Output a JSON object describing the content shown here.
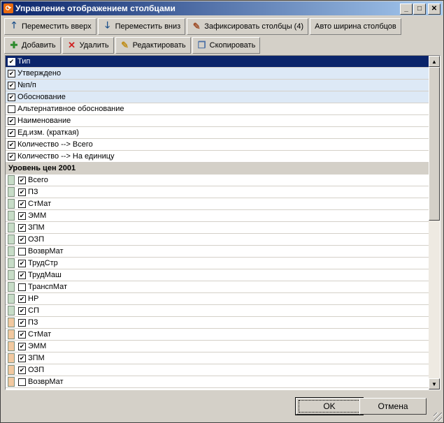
{
  "window": {
    "title": "Управление отображением столбцами"
  },
  "toolbar1": [
    {
      "label": "Переместить вверх",
      "icon": "arrow-up-icon"
    },
    {
      "label": "Переместить вниз",
      "icon": "arrow-down-icon"
    },
    {
      "label": "Зафиксировать столбцы (4)",
      "icon": "pin-icon"
    },
    {
      "label": "Авто ширина столбцов",
      "icon": ""
    }
  ],
  "toolbar2": [
    {
      "label": "Добавить",
      "icon": "plus-icon"
    },
    {
      "label": "Удалить",
      "icon": "delete-x-icon"
    },
    {
      "label": "Редактировать",
      "icon": "edit-icon"
    },
    {
      "label": "Скопировать",
      "icon": "copy-icon"
    }
  ],
  "rows": [
    {
      "label": "Тип",
      "checked": true,
      "style": "selected"
    },
    {
      "label": "Утверждено",
      "checked": true,
      "style": "alt"
    },
    {
      "label": "№п/п",
      "checked": true,
      "style": "alt"
    },
    {
      "label": "Обоснование",
      "checked": true,
      "style": "alt"
    },
    {
      "label": "Альтернативное обоснование",
      "checked": false,
      "style": ""
    },
    {
      "label": "Наименование",
      "checked": true,
      "style": ""
    },
    {
      "label": "Ед.изм. (краткая)",
      "checked": true,
      "style": ""
    },
    {
      "label": "Количество --> Всего",
      "checked": true,
      "style": ""
    },
    {
      "label": "Количество --> На единицу",
      "checked": true,
      "style": ""
    },
    {
      "label": "Уровень цен 2001",
      "group": true
    },
    {
      "label": "Всего",
      "checked": true,
      "swatch": "#c7dcc7"
    },
    {
      "label": "ПЗ",
      "checked": true,
      "swatch": "#c7dcc7"
    },
    {
      "label": "СтМат",
      "checked": true,
      "swatch": "#c7dcc7"
    },
    {
      "label": "ЭММ",
      "checked": true,
      "swatch": "#c7dcc7"
    },
    {
      "label": "ЗПМ",
      "checked": true,
      "swatch": "#c7dcc7"
    },
    {
      "label": "ОЗП",
      "checked": true,
      "swatch": "#c7dcc7"
    },
    {
      "label": "ВозврМат",
      "checked": false,
      "swatch": "#c7dcc7"
    },
    {
      "label": "ТрудСтр",
      "checked": true,
      "swatch": "#c7dcc7"
    },
    {
      "label": "ТрудМаш",
      "checked": true,
      "swatch": "#c7dcc7"
    },
    {
      "label": "ТранспМат",
      "checked": false,
      "swatch": "#c7dcc7"
    },
    {
      "label": "НР",
      "checked": true,
      "swatch": "#c7dcc7"
    },
    {
      "label": "СП",
      "checked": true,
      "swatch": "#c7dcc7"
    },
    {
      "label": "ПЗ",
      "checked": true,
      "swatch": "#f2c9a0"
    },
    {
      "label": "СтМат",
      "checked": true,
      "swatch": "#f2c9a0"
    },
    {
      "label": "ЭММ",
      "checked": true,
      "swatch": "#f2c9a0"
    },
    {
      "label": "ЗПМ",
      "checked": true,
      "swatch": "#f2c9a0"
    },
    {
      "label": "ОЗП",
      "checked": true,
      "swatch": "#f2c9a0"
    },
    {
      "label": "ВозврМат",
      "checked": false,
      "swatch": "#f2c9a0"
    }
  ],
  "footer": {
    "ok_label": "OK",
    "cancel_label": "Отмена"
  }
}
